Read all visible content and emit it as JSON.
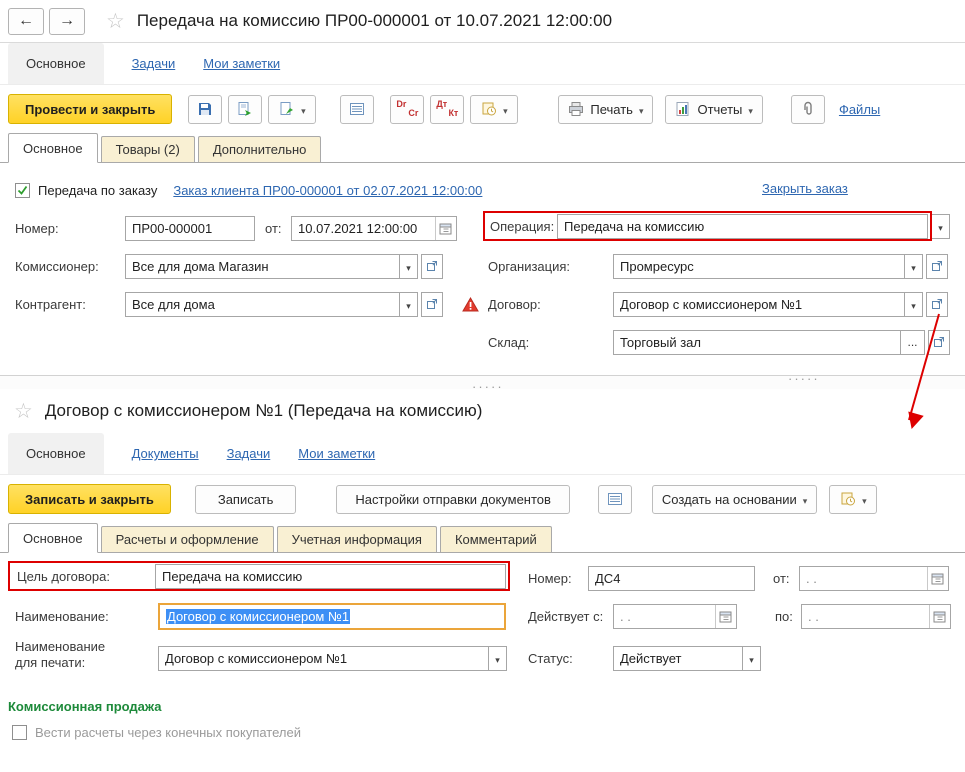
{
  "colors": {
    "accent_yellow": "#ffd633",
    "highlight_red": "#dd0000",
    "link_blue": "#2e67b1",
    "section_green": "#1d8a3a",
    "selection_blue": "#3d8ff5"
  },
  "w1": {
    "title": "Передача на комиссию ПР00-000001 от 10.07.2021 12:00:00",
    "nav": [
      {
        "label": "Основное"
      },
      {
        "label": "Задачи"
      },
      {
        "label": "Мои заметки"
      }
    ],
    "toolbar": {
      "post_and_close": "Провести и закрыть",
      "drcr_lat_top": "Dr",
      "drcr_lat_bottom": "Cr",
      "drcr_cyr_top": "Дт",
      "drcr_cyr_bottom": "Кт",
      "print_label": "Печать",
      "reports_label": "Отчеты",
      "files_label": "Файлы"
    },
    "tabs": [
      {
        "label": "Основное"
      },
      {
        "label": "Товары (2)"
      },
      {
        "label": "Дополнительно"
      }
    ],
    "order": {
      "checkbox_label": "Передача по заказу",
      "order_link": "Заказ клиента ПР00-000001 от 02.07.2021 12:00:00",
      "close_link": "Закрыть заказ"
    },
    "fields": {
      "number_label": "Номер:",
      "number_value": "ПР00-000001",
      "date_label": "от:",
      "date_value": "10.07.2021 12:00:00",
      "operation_label": "Операция:",
      "operation_value": "Передача на комиссию",
      "commissioner_label": "Комиссионер:",
      "commissioner_value": "Все для дома Магазин",
      "organization_label": "Организация:",
      "organization_value": "Промресурс",
      "counterparty_label": "Контрагент:",
      "counterparty_value": "Все для дома",
      "contract_label": "Договор:",
      "contract_value": "Договор с комиссионером №1",
      "warehouse_label": "Склад:",
      "warehouse_value": "Торговый зал",
      "warehouse_more": "..."
    }
  },
  "w2": {
    "title": "Договор с комиссионером №1  (Передача на комиссию)",
    "nav": [
      {
        "label": "Основное"
      },
      {
        "label": "Документы"
      },
      {
        "label": "Задачи"
      },
      {
        "label": "Мои заметки"
      }
    ],
    "toolbar": {
      "save_and_close": "Записать и закрыть",
      "save": "Записать",
      "send_settings": "Настройки отправки документов",
      "create_based_on": "Создать на основании"
    },
    "tabs": [
      {
        "label": "Основное"
      },
      {
        "label": "Расчеты и оформление"
      },
      {
        "label": "Учетная информация"
      },
      {
        "label": "Комментарий"
      }
    ],
    "fields": {
      "purpose_label": "Цель договора:",
      "purpose_value": "Передача на комиссию",
      "number_label": "Номер:",
      "number_value": "ДС4",
      "from_label": "от:",
      "from_value": ". .",
      "name_label": "Наименование:",
      "name_value": "Договор с комиссионером №1",
      "valid_from_label": "Действует с:",
      "valid_from_value": ". .",
      "valid_to_label": "по:",
      "valid_to_value": ". .",
      "print_name_label_1": "Наименование",
      "print_name_label_2": "для печати:",
      "print_name_value": "Договор с комиссионером №1",
      "status_label": "Статус:",
      "status_value": "Действует"
    },
    "section_header": "Комиссионная продажа",
    "settlements_checkbox_label": "Вести расчеты через конечных покупателей"
  }
}
